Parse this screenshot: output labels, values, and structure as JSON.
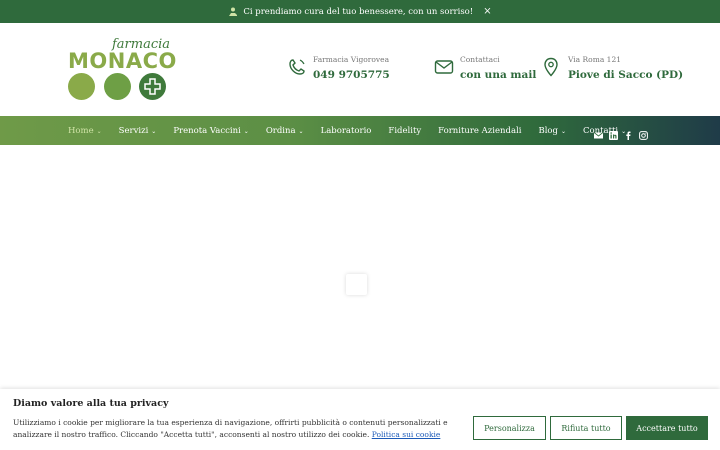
{
  "announcement": {
    "text": "Ci prendiamo cura del tuo benessere, con un sorriso!",
    "close": "×"
  },
  "logo": {
    "script": "farmacia",
    "main": "MONACO"
  },
  "contacts": [
    {
      "icon": "phone-icon",
      "label": "Farmacia Vigorovea",
      "value": "049 9705775"
    },
    {
      "icon": "mail-icon",
      "label": "Contattaci",
      "value": "con una mail"
    },
    {
      "icon": "location-pin-icon",
      "label": "Via Roma 121",
      "value": "Piove di Sacco (PD)"
    }
  ],
  "nav": {
    "items": [
      {
        "label": "Home",
        "dropdown": true,
        "active": true
      },
      {
        "label": "Servizi",
        "dropdown": true
      },
      {
        "label": "Prenota Vaccini",
        "dropdown": true
      },
      {
        "label": "Ordina",
        "dropdown": true
      },
      {
        "label": "Laboratorio",
        "dropdown": false
      },
      {
        "label": "Fidelity",
        "dropdown": false
      },
      {
        "label": "Forniture Aziendali",
        "dropdown": false
      },
      {
        "label": "Blog",
        "dropdown": true
      },
      {
        "label": "Contatti",
        "dropdown": true
      }
    ],
    "chevron": "⌄",
    "social": [
      "envelope-icon",
      "linkedin-icon",
      "facebook-icon",
      "instagram-icon"
    ]
  },
  "cookie": {
    "title": "Diamo valore alla tua privacy",
    "text": "Utilizziamo i cookie per migliorare la tua esperienza di navigazione, offrirti pubblicità o contenuti personalizzati e analizzare il nostro traffico. Cliccando \"Accetta tutti\", acconsenti al nostro utilizzo dei cookie.",
    "link": "Politica sui cookie",
    "buttons": {
      "customize": "Personalizza",
      "reject": "Rifiuta tutto",
      "accept": "Accettare tutto"
    }
  },
  "colors": {
    "brand_green": "#2f6a3c",
    "light_green": "#8aaa49",
    "mid_green": "#6e9f45"
  }
}
